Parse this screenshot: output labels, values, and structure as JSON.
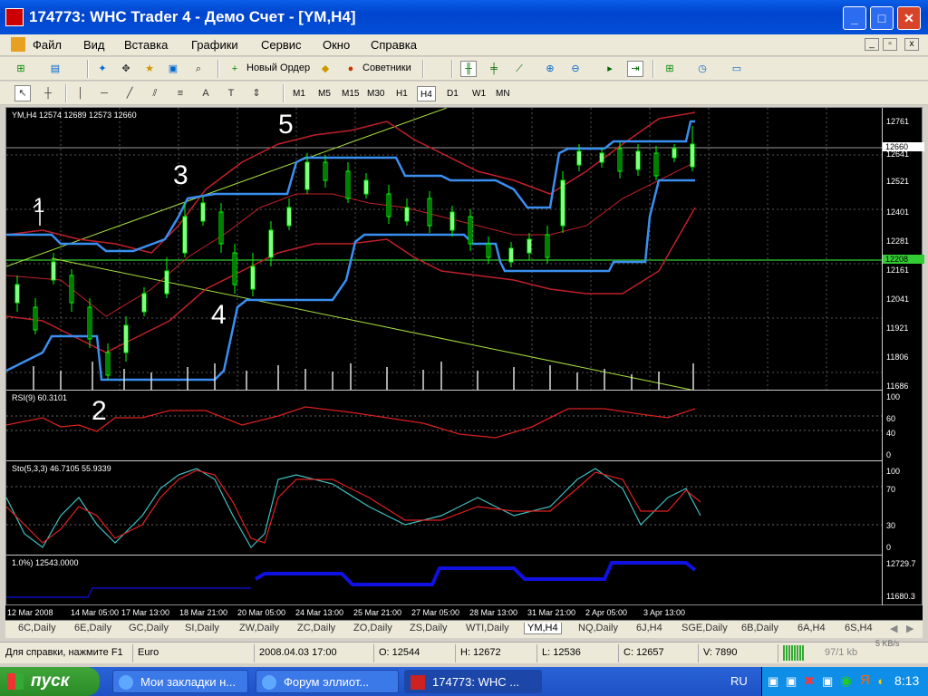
{
  "window": {
    "title": "174773: WHC Trader 4 - Демо Счет - [YM,H4]"
  },
  "menu": [
    "Файл",
    "Вид",
    "Вставка",
    "Графики",
    "Сервис",
    "Окно",
    "Справка"
  ],
  "toolbar": {
    "new_order": "Новый Ордер",
    "experts": "Советники"
  },
  "timeframes": [
    "M1",
    "M5",
    "M15",
    "M30",
    "H1",
    "H4",
    "D1",
    "W1",
    "MN"
  ],
  "active_timeframe": "H4",
  "main_label": "YM,H4  12574 12689 12573 12660",
  "price_scale": [
    "12761",
    "12641",
    "12521",
    "12401",
    "12281",
    "12161",
    "12041",
    "11921",
    "11806",
    "11686"
  ],
  "price_current": "12660",
  "price_line": "12208",
  "rsi_label": "RSI(9) 60.3101",
  "rsi_scale": [
    "100",
    "60",
    "40",
    "0"
  ],
  "sto_label": "Sto(5,3,3) 46.7105 55.9339",
  "sto_scale": [
    "100",
    "70",
    "30",
    "0"
  ],
  "ind_label": "1.0%) 12543.0000",
  "ind_scale": [
    "12729.7",
    "11680.3"
  ],
  "time_axis": [
    "12 Mar 2008",
    "14 Mar 05:00",
    "17 Mar 13:00",
    "18 Mar 21:00",
    "20 Mar 05:00",
    "24 Mar 13:00",
    "25 Mar 21:00",
    "27 Mar 05:00",
    "28 Mar 13:00",
    "31 Mar 21:00",
    "2 Apr 05:00",
    "3 Apr 13:00"
  ],
  "annotations": [
    "1",
    "2",
    "3",
    "4",
    "5"
  ],
  "tabs": [
    "6C,Daily",
    "6E,Daily",
    "GC,Daily",
    "SI,Daily",
    "ZW,Daily",
    "ZC,Daily",
    "ZO,Daily",
    "ZS,Daily",
    "WTI,Daily",
    "YM,H4",
    "NQ,Daily",
    "6J,H4",
    "SGE,Daily",
    "6B,Daily",
    "6A,H4",
    "6S,H4"
  ],
  "active_tab": "YM,H4",
  "status": {
    "help": "Для справки, нажмите F1",
    "profile": "Euro",
    "datetime": "2008.04.03 17:00",
    "open": "O: 12544",
    "high": "H: 12672",
    "low": "L: 12536",
    "close": "C: 12657",
    "volume": "V: 7890",
    "traffic": "97/1 kb",
    "speed": "5 KB/s"
  },
  "taskbar": {
    "start": "пуск",
    "tasks": [
      "Мои закладки н...",
      "Форум эллиот...",
      "174773: WHC ..."
    ],
    "lang": "RU",
    "clock": "8:13"
  },
  "colors": {
    "candle_up": "#00ff00",
    "bb_red": "#c0202a",
    "channel_blue": "#3a8ff0",
    "trend_green": "#a8e040",
    "rsi_red": "#d82020",
    "sto_main": "#40c0c0",
    "sto_signal": "#e02020",
    "ind_blue": "#1010e0"
  }
}
